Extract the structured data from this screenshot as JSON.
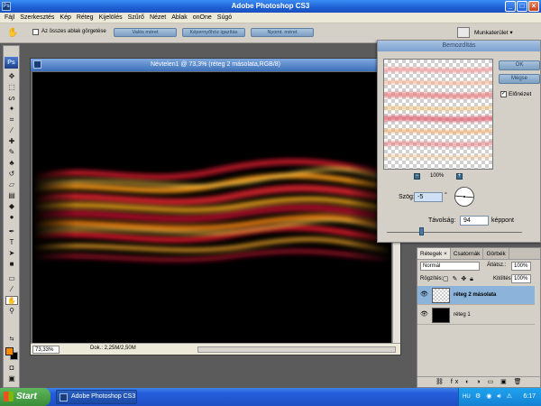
{
  "app": {
    "title": "Adobe Photoshop CS3",
    "logo": "Ps"
  },
  "window_controls": {
    "minimize": "_",
    "maximize": "□",
    "close": "×"
  },
  "menu": [
    "Fájl",
    "Szerkesztés",
    "Kép",
    "Réteg",
    "Kijelölés",
    "Szűrő",
    "Nézet",
    "Ablak",
    "onOne",
    "Súgó"
  ],
  "options_bar": {
    "scroll_all_windows": "Az összes ablak görgetése",
    "actual_pixels": "Valós méret",
    "fit_screen": "Képernyőhöz igazítás",
    "print_size": "Nyomt. méret",
    "workspace": "Munkaterület ▾"
  },
  "tools": {
    "logo": "Ps",
    "foreground_color": "#ff8a00",
    "background_color": "#000000"
  },
  "document": {
    "title": "Névtelen1 @ 73,3% (réteg 2 másolata,RGB/8)",
    "zoom": "73,33%",
    "info": "Dok.: 2,25M/2,50M"
  },
  "motion_blur_dialog": {
    "title": "Bemozdítás",
    "ok_label": "OK",
    "cancel_label": "Mégse",
    "preview_checkbox_label": "Előnézet",
    "preview_checked": true,
    "preview_zoom": "100%",
    "zoom_out": "−",
    "zoom_in": "+",
    "angle_label": "Szög:",
    "angle_value": "-5",
    "angle_unit": "°",
    "distance_label": "Távolság:",
    "distance_value": "94",
    "distance_unit": "képpont"
  },
  "layers_panel": {
    "tabs": [
      "Rétegek ×",
      "Csatornák",
      "Görbék"
    ],
    "blend_mode": "Normál",
    "opacity_label": "Átlátsz.:",
    "opacity_value": "100%",
    "lock_label": "Rögzítés:",
    "fill_label": "Kitöltés:",
    "fill_value": "100%",
    "layers": [
      {
        "name": "réteg 2 másolata",
        "selected": true
      },
      {
        "name": "réteg 1",
        "selected": false
      }
    ]
  },
  "taskbar": {
    "start_label": "Start",
    "task_label": "Adobe Photoshop CS3",
    "language": "HU",
    "clock": "6:17"
  }
}
